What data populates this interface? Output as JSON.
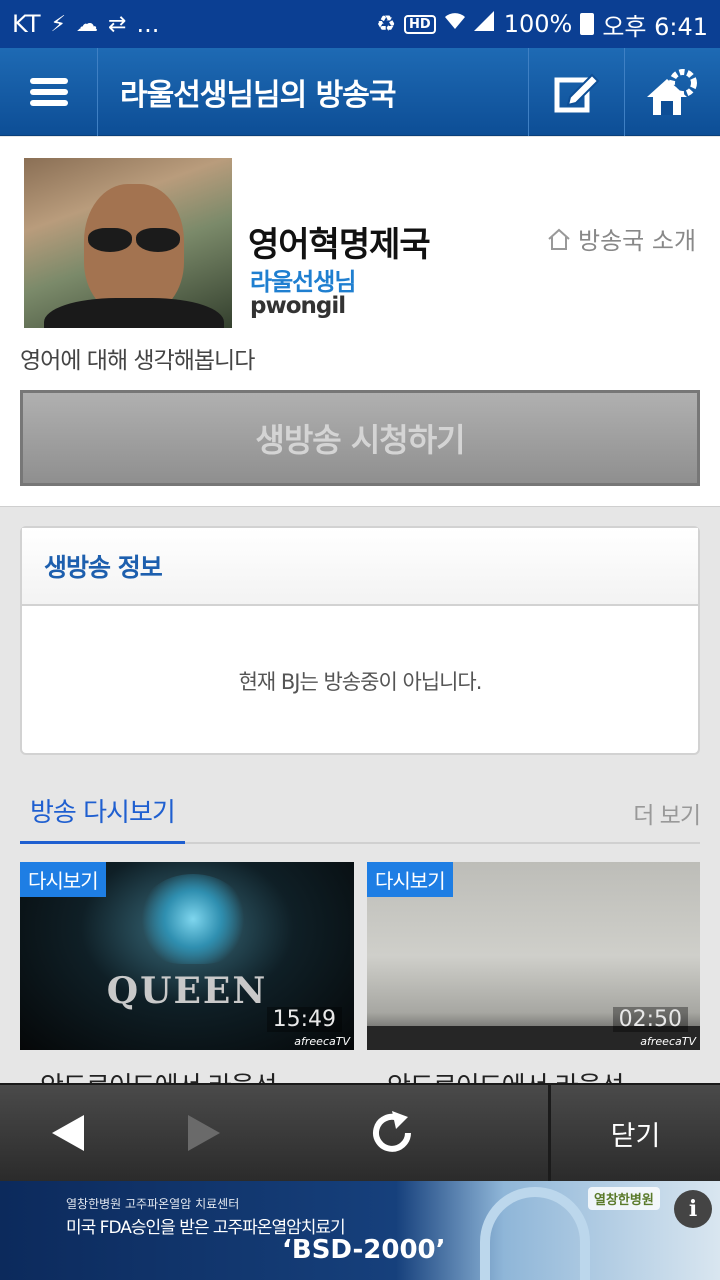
{
  "status_bar": {
    "carrier": "KT",
    "more": "...",
    "battery": "100%",
    "time": "오후 6:41",
    "hd": "HD"
  },
  "header": {
    "title": "라울선생님님의 방송국"
  },
  "profile": {
    "station_name": "영어혁명제국",
    "bj_nickname": "라울선생님",
    "bj_id": "pwongil",
    "intro_link": "방송국 소개",
    "description": "영어에 대해 생각해봅니다",
    "watch_button": "생방송 시청하기"
  },
  "live_info": {
    "title": "생방송 정보",
    "message": "현재 BJ는 방송중이 아닙니다."
  },
  "replay": {
    "tab_label": "방송 다시보기",
    "more_label": "더 보기",
    "items": [
      {
        "badge": "다시보기",
        "duration": "15:49",
        "caption": "안드로이드에서 라울선",
        "thumb_text": "QUEEN",
        "watermark": "afreecaTV"
      },
      {
        "badge": "다시보기",
        "duration": "02:50",
        "caption": "안드로이드에서 라울선",
        "watermark": "afreecaTV"
      }
    ]
  },
  "nav": {
    "close_label": "닫기"
  },
  "ad": {
    "line1": "열창한병원 고주파온열암 치료센터",
    "line2": "미국 FDA승인을 받은 고주파온열암치료기",
    "line3": "‘BSD-2000’",
    "logo": "열창한병원",
    "info": "i"
  },
  "colors": {
    "status_bar": "#0b3f93",
    "header": "#1e6ab4",
    "accent_blue": "#1f5fd0",
    "badge": "#1e7ee4"
  }
}
